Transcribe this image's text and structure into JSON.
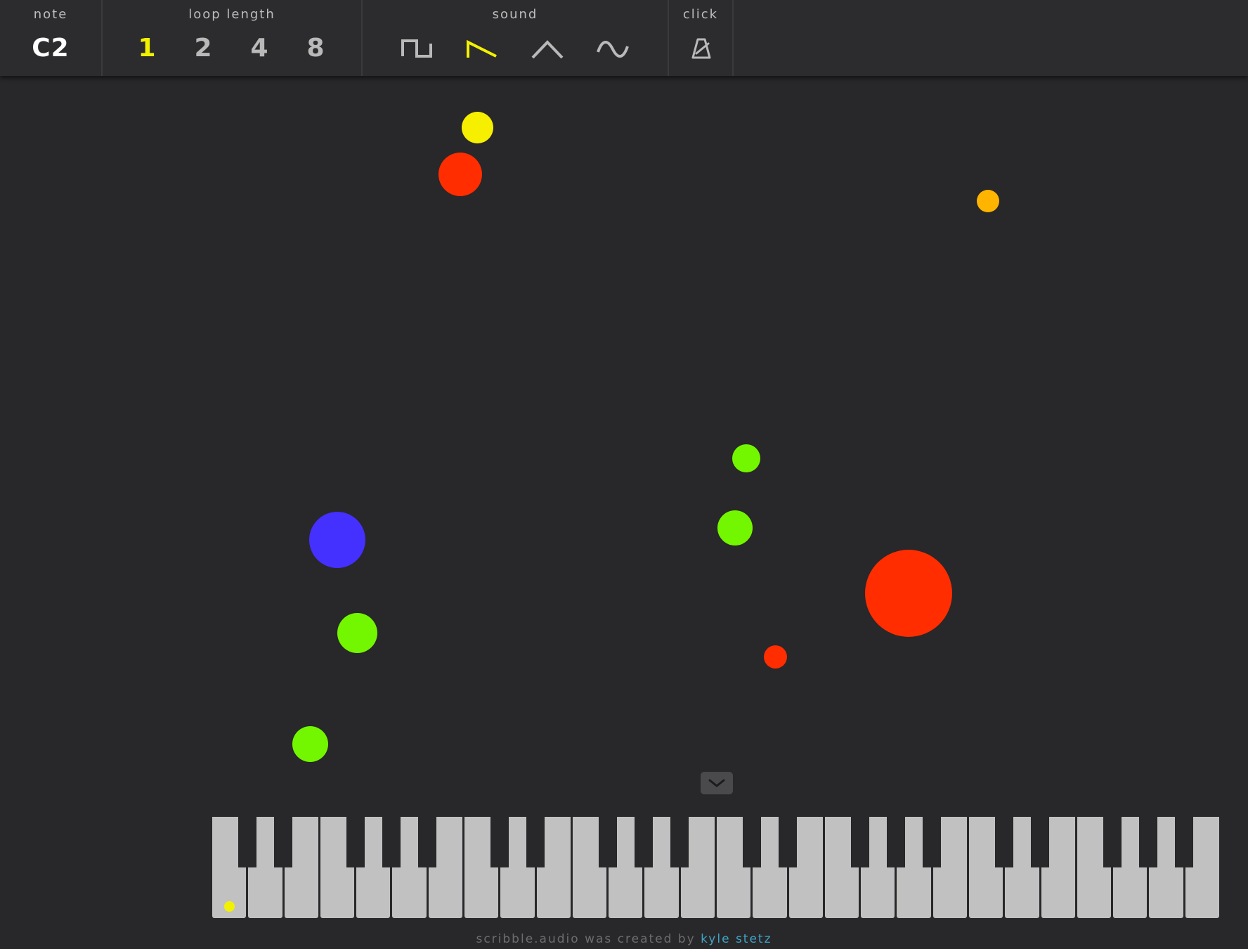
{
  "toolbar": {
    "note": {
      "label": "note",
      "value": "C2"
    },
    "loop_length": {
      "label": "loop length",
      "options": [
        "1",
        "2",
        "4",
        "8"
      ],
      "selected": "1"
    },
    "sound": {
      "label": "sound",
      "options": [
        "square-wave-icon",
        "sawtooth-wave-icon",
        "triangle-wave-icon",
        "sine-wave-icon"
      ],
      "selected": "sawtooth-wave-icon"
    },
    "click": {
      "label": "click",
      "icon": "metronome-icon"
    }
  },
  "colors": {
    "background": "#282729",
    "toolbar": "#2c2b2d",
    "active": "#f2f200",
    "inactive": "#b9b9b9",
    "white_key": "#c1c1c1",
    "link": "#3fa4c6",
    "note_red": "#ff2d00",
    "note_yellow": "#f7ef00",
    "note_orange": "#ffb400",
    "note_green": "#73f700",
    "note_blue": "#4430ff"
  },
  "stage": {
    "dots": [
      {
        "name": "note-dot-yellow",
        "color": "#f7ef00"
      },
      {
        "name": "note-dot-red",
        "color": "#ff2d00"
      },
      {
        "name": "note-dot-orange",
        "color": "#ffb400"
      },
      {
        "name": "note-dot-green",
        "color": "#73f700"
      },
      {
        "name": "note-dot-green",
        "color": "#73f700"
      },
      {
        "name": "note-dot-blue",
        "color": "#4430ff"
      },
      {
        "name": "note-dot-red-large",
        "color": "#ff2d00"
      },
      {
        "name": "note-dot-green",
        "color": "#73f700"
      },
      {
        "name": "note-dot-red-small",
        "color": "#ff2d00"
      },
      {
        "name": "note-dot-green",
        "color": "#73f700"
      }
    ]
  },
  "keyboard": {
    "collapse_icon": "chevron-down-icon",
    "white_key_count": 28,
    "active_key_marker_color": "#f2f200"
  },
  "footer": {
    "text": "scribble.audio was created by",
    "link": "kyle stetz"
  }
}
